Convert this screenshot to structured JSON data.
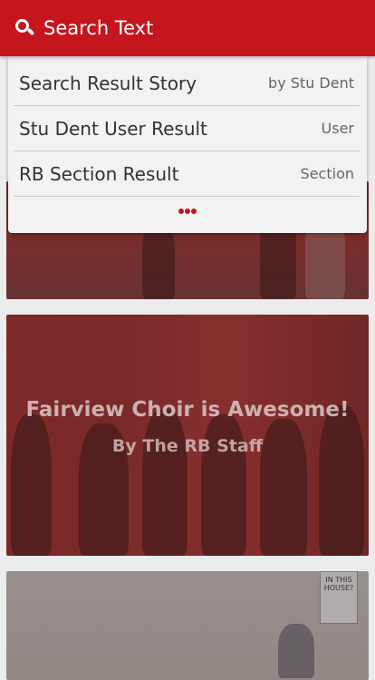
{
  "header": {
    "title": "Search Text",
    "icon": "search-icon",
    "background_color": "#c4161c"
  },
  "search_results": [
    {
      "label": "Search Result Story",
      "kind": "by Stu Dent"
    },
    {
      "label": "Stu Dent User Result",
      "kind": "User"
    },
    {
      "label": "RB Section Result",
      "kind": "Section"
    }
  ],
  "more_icon": "more-dots-icon",
  "feed": {
    "story2": {
      "headline": "Fairview Choir is Awesome!",
      "byline": "By The RB Staff"
    },
    "story3": {
      "poster_text": "IN THIS HOUSE?"
    }
  }
}
